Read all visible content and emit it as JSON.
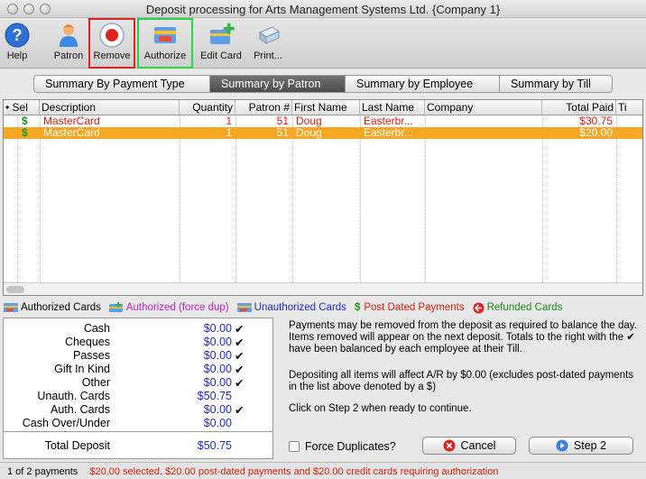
{
  "window": {
    "title": "Deposit processing for Arts Management Systems Ltd. {Company 1}"
  },
  "toolbar": {
    "buttons": [
      {
        "label": "Help",
        "icon": "help-icon"
      },
      {
        "label": "Patron",
        "icon": "patron-icon"
      },
      {
        "label": "Remove",
        "icon": "remove-icon"
      },
      {
        "label": "Authorize",
        "icon": "authorize-icon"
      },
      {
        "label": "Edit Card",
        "icon": "edit-card-icon"
      },
      {
        "label": "Print...",
        "icon": "print-icon"
      }
    ]
  },
  "tabs": [
    {
      "label": "Summary By Payment Type",
      "active": false
    },
    {
      "label": "Summary by Patron",
      "active": true
    },
    {
      "label": "Summary by Employee",
      "active": false
    },
    {
      "label": "Summary by Till",
      "active": false
    }
  ],
  "grid": {
    "headers": [
      "• Sel",
      "Description",
      "Quantity",
      "Patron #",
      "First Name",
      "Last Name",
      "Company",
      "Total Paid",
      "Ti"
    ],
    "rows": [
      {
        "sel": "$",
        "description": "MasterCard",
        "quantity": "1",
        "patron": "51",
        "first": "Doug",
        "last": "Easterbr...",
        "company": "",
        "total": "$30.75",
        "selected": false
      },
      {
        "sel": "$",
        "description": "MasterCard",
        "quantity": "1",
        "patron": "51",
        "first": "Doug",
        "last": "Easterbr...",
        "company": "",
        "total": "$20.00",
        "selected": true
      }
    ]
  },
  "legend": [
    {
      "label": "Authorized Cards",
      "color": "#000000",
      "icon": "authorized-card-icon"
    },
    {
      "label": "Authorized (force dup)",
      "color": "#c21fc2",
      "icon": "authorized-force-dup-icon"
    },
    {
      "label": "Unauthorized Cards",
      "color": "#1f2ad1",
      "icon": "unauthorized-card-icon"
    },
    {
      "label": "Post Dated Payments",
      "color": "#d8200e",
      "icon": "dollar-icon"
    },
    {
      "label": "Refunded Cards",
      "color": "#1a8a1a",
      "icon": "refund-icon"
    }
  ],
  "summary": {
    "rows": [
      {
        "label": "Cash",
        "value": "$0.00",
        "check": "✔"
      },
      {
        "label": "Cheques",
        "value": "$0.00",
        "check": "✔"
      },
      {
        "label": "Passes",
        "value": "$0.00",
        "check": "✔"
      },
      {
        "label": "Gift In Kind",
        "value": "$0.00",
        "check": "✔"
      },
      {
        "label": "Other",
        "value": "$0.00",
        "check": "✔"
      },
      {
        "label": "Unauth. Cards",
        "value": "$50.75",
        "check": ""
      },
      {
        "label": "Auth. Cards",
        "value": "$0.00",
        "check": "✔"
      },
      {
        "label": "Cash Over/Under",
        "value": "$0.00",
        "check": ""
      }
    ],
    "total": {
      "label": "Total Deposit",
      "value": "$50.75"
    }
  },
  "info": {
    "p1": "Payments may be removed from the deposit as required to balance the day.  Items removed will appear on the next deposit.  Totals to the right with the ✔ have been balanced by each employee at their Till.",
    "p2": "Depositing all items will affect A/R by $0.00 (excludes post-dated payments in the list above denoted by a $)",
    "p3": "Click on Step 2 when ready to continue."
  },
  "actions": {
    "force_duplicates": "Force Duplicates?",
    "cancel": "Cancel",
    "step2": "Step 2"
  },
  "status": {
    "count": "1 of 2 payments",
    "message": "$20.00 selected. $20.00 post-dated payments and $20.00 credit cards requiring authorization"
  },
  "colors": {
    "selected_row": "#f5a623",
    "red_text": "#d8200e",
    "blue_value": "#1f2ad1",
    "accent": "#3b7fe0"
  }
}
